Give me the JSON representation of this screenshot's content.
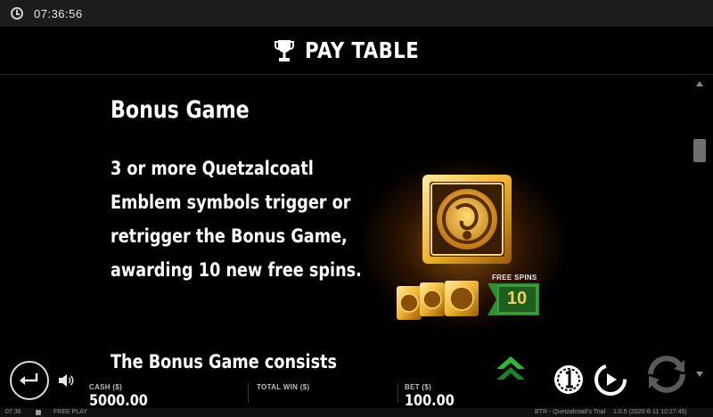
{
  "status_bar": {
    "time": "07:36:56",
    "icon": "clock-icon"
  },
  "header": {
    "icon": "trophy-icon",
    "title": "PAY TABLE"
  },
  "content": {
    "section_title": "Bonus Game",
    "description_lines": [
      "3 or more Quetzalcoatl",
      "Emblem symbols trigger or",
      "retrigger the Bonus Game,",
      "awarding 10 new free spins."
    ],
    "subtitle": "The Bonus Game consists",
    "free_spins_label": "FREE SPINS",
    "free_spins_value": "10",
    "emblem_icon": "quetzalcoatl-emblem-icon"
  },
  "bottom_bar": {
    "cash_label": "CASH ($)",
    "cash_value": "5000.00",
    "total_win_label": "TOTAL WIN ($)",
    "total_win_value": "",
    "bet_label": "BET ($)",
    "bet_value": "100.00"
  },
  "footer": {
    "time": "07:36",
    "mode": "FREE PLAY",
    "game": "BTR - Quetzalcoatl's Trial",
    "version": "1.0.5 (2020-8-11 10:27:45)"
  },
  "colors": {
    "accent_gold": "#f2c14e",
    "badge_green": "#2f8f2f",
    "background": "#000000"
  }
}
